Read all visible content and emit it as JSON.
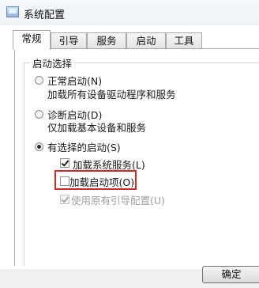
{
  "window": {
    "title": "系统配置"
  },
  "tabs": [
    {
      "label": "常规",
      "active": true
    },
    {
      "label": "引导",
      "active": false
    },
    {
      "label": "服务",
      "active": false
    },
    {
      "label": "启动",
      "active": false
    },
    {
      "label": "工具",
      "active": false
    }
  ],
  "startup_selection": {
    "group_label": "启动选择",
    "options": [
      {
        "label": "正常启动(N)",
        "description": "加载所有设备驱动程序和服务",
        "selected": false
      },
      {
        "label": "诊断启动(D)",
        "description": "仅加载基本设备和服务",
        "selected": false
      },
      {
        "label": "有选择的启动(S)",
        "selected": true
      }
    ],
    "checkboxes": [
      {
        "label": "加载系统服务(L)",
        "checked": true,
        "enabled": true
      },
      {
        "label": "加载启动项(O)",
        "checked": false,
        "enabled": true
      },
      {
        "label": "使用原有引导配置(U)",
        "checked": true,
        "enabled": false
      }
    ]
  },
  "buttons": {
    "ok": "确定"
  },
  "colors": {
    "highlight": "#d12a2a"
  }
}
